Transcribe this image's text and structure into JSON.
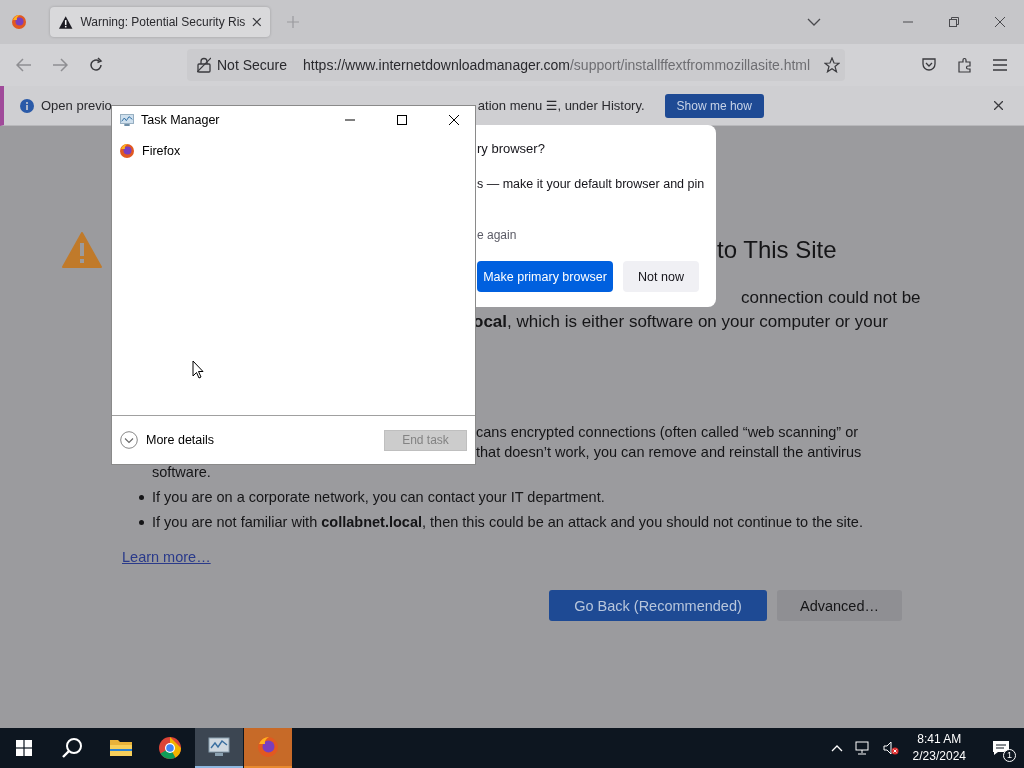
{
  "browser": {
    "tabs": [
      {
        "title": "Warning: Potential Security Ris",
        "selected": true
      }
    ],
    "address_bar": {
      "security_label": "Not Secure",
      "url_host": "https://www.internetdownloadmanager.com",
      "url_path": "/support/installffextfrommozillasite.html"
    },
    "notification": {
      "text_start": "Open previo",
      "text_end": "ation menu ☰, under History.",
      "button": "Show me how"
    },
    "page": {
      "heading": "to This Site",
      "paragraph_lines": [
        {
          "text": "connection could not be",
          "kind": "right"
        },
        {
          "text": "**ocal**, which is either software on your computer or your",
          "kind": "mid"
        }
      ],
      "bullet_lines": [
        {
          "text": "cans encrypted connections (often called “web scanning” or",
          "kind": "mid"
        },
        {
          "text": "that doesn’t work, you can remove and reinstall the antivirus",
          "kind": "mid"
        },
        {
          "text": "software.",
          "kind": "full"
        }
      ],
      "bullets": [
        "If you are on a corporate network, you can contact your IT department.",
        "If you are not familiar with **collabnet.local**, then this could be an attack and you should not continue to the site."
      ],
      "link": "Learn more…",
      "buttons": [
        {
          "label": "Go Back (Recommended)",
          "kind": "primary"
        },
        {
          "label": "Advanced…",
          "kind": "secondary"
        }
      ]
    }
  },
  "default_browser_prompt": {
    "title": "ry browser?",
    "body": "s — make it your default browser and pin",
    "checkbox_label": "e again",
    "buttons": [
      {
        "label": "Make primary browser",
        "kind": "primary"
      },
      {
        "label": "Not now",
        "kind": "secondary"
      }
    ]
  },
  "task_manager": {
    "title": "Task Manager",
    "apps": [
      {
        "name": "Firefox"
      }
    ],
    "more_details": "More details",
    "end_task": {
      "label": "End task",
      "disabled": true
    }
  },
  "taskbar": {
    "apps": [
      {
        "kind": "explorer",
        "running": false,
        "selected": false,
        "attention": false
      },
      {
        "kind": "chrome",
        "running": false,
        "selected": false,
        "attention": false
      },
      {
        "kind": "taskmgr",
        "running": true,
        "selected": true,
        "attention": false
      },
      {
        "kind": "firefox",
        "running": true,
        "selected": false,
        "attention": true
      }
    ],
    "time": "8:41 AM",
    "date": "2/23/2024",
    "notification_count": "1"
  }
}
